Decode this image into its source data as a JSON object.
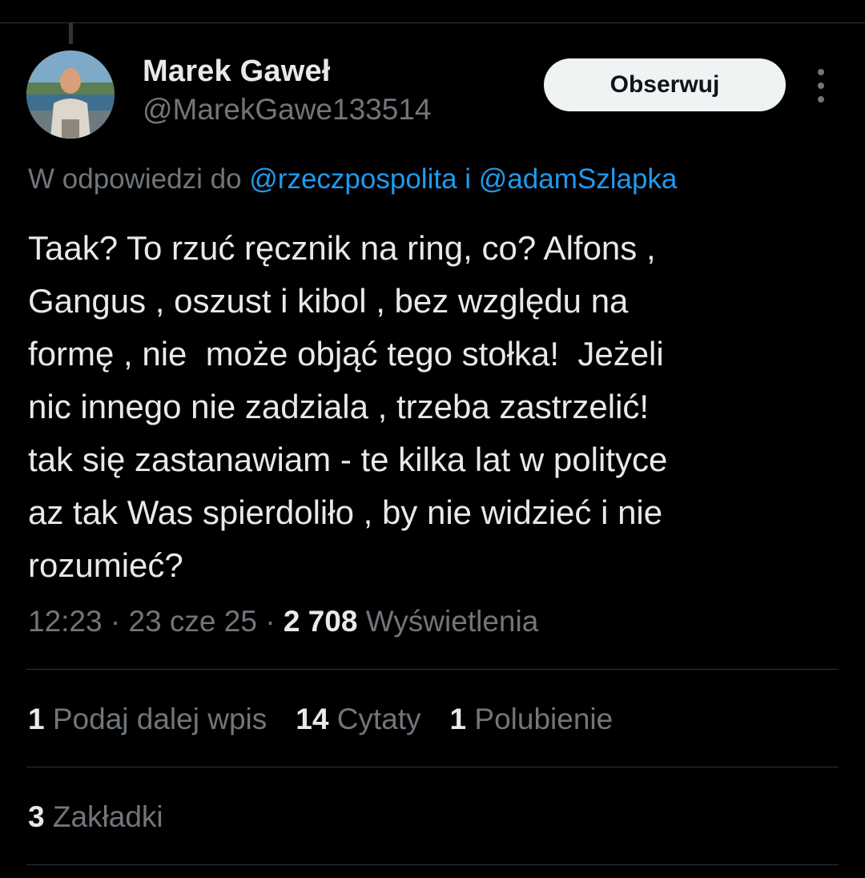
{
  "author": {
    "name": "Marek Gaweł",
    "handle": "@MarekGawe133514"
  },
  "follow_button": {
    "label": "Obserwuj"
  },
  "more_icon": "more-vertical-icon",
  "reply_to": {
    "prefix": "W odpowiedzi do",
    "mention_1": "@rzeczpospolita",
    "conjunction": "i",
    "mention_2": "@adamSzlapka"
  },
  "tweet": {
    "text": "Taak? To rzuć ręcznik na ring, co? Alfons ,\nGangus , oszust i kibol , bez względu na\nformę , nie  może objąć tego stołka!  Jeżeli\nnic innego nie zadziala , trzeba zastrzelić!\ntak się zastanawiam - te kilka lat w polityce\naz tak Was spierdoliło , by nie widzieć i nie\nrozumieć?"
  },
  "meta": {
    "time": "12:23",
    "date": "23 cze 25",
    "separator": "·",
    "views_count": "2 708",
    "views_label": "Wyświetlenia"
  },
  "stats": {
    "reposts_count": "1",
    "reposts_label": "Podaj dalej wpis",
    "quotes_count": "14",
    "quotes_label": "Cytaty",
    "likes_count": "1",
    "likes_label": "Polubienie"
  },
  "bookmarks": {
    "count": "3",
    "label": "Zakładki"
  },
  "colors": {
    "background": "#000000",
    "text_primary": "#e7e9ea",
    "text_secondary": "#71767b",
    "link": "#1d9bf0",
    "divider": "#2f3336",
    "button_bg": "#eff3f4"
  }
}
